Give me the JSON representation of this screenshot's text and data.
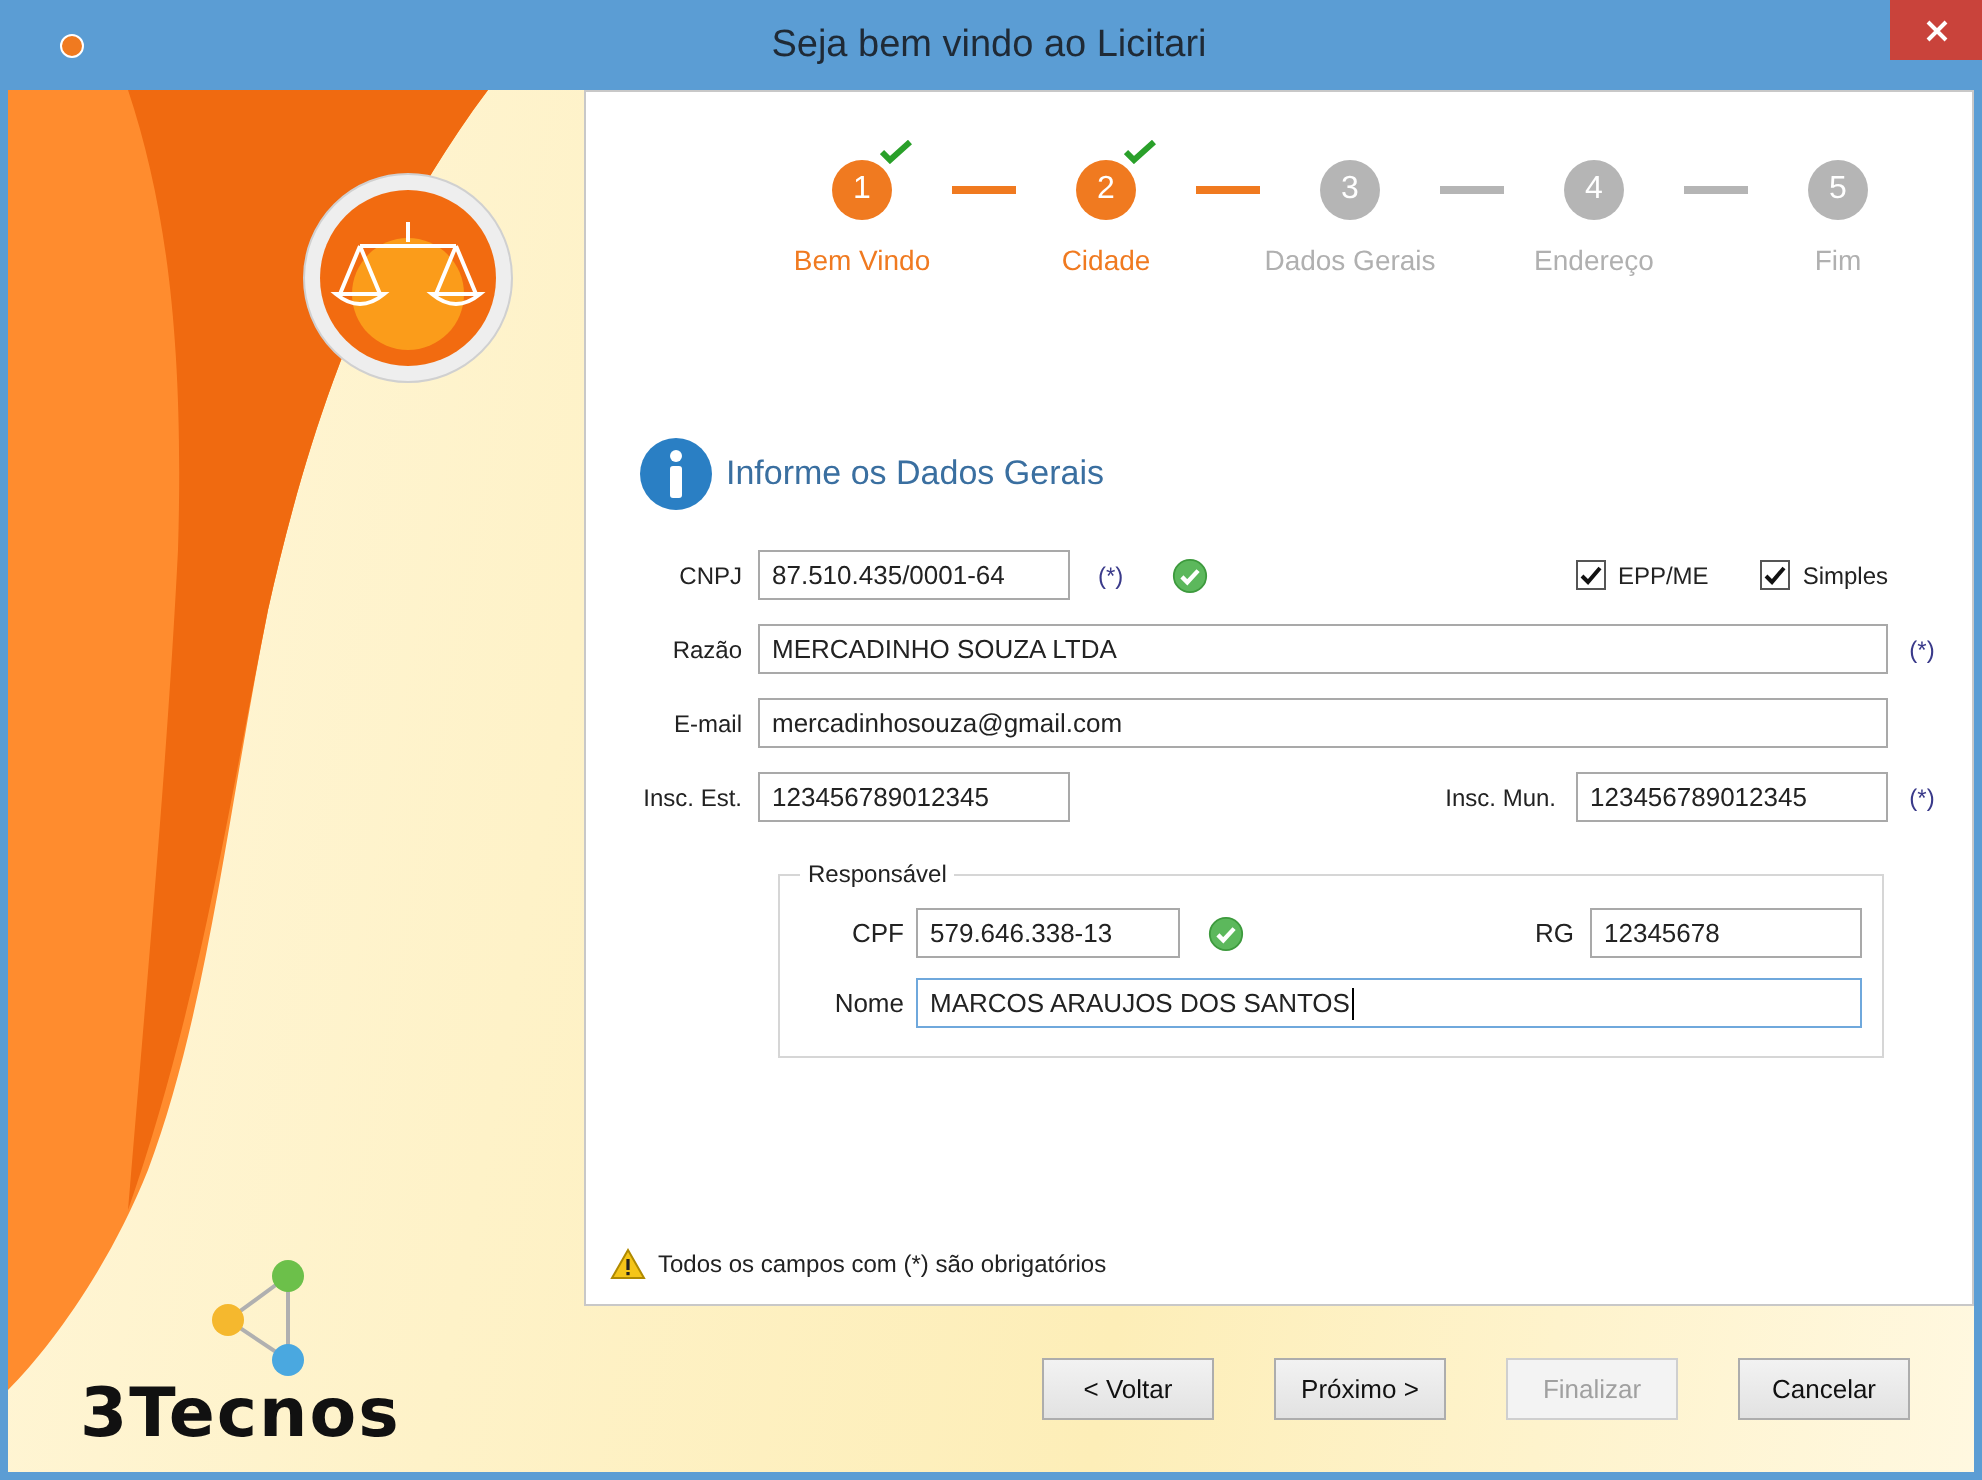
{
  "window": {
    "title": "Seja bem vindo ao Licitari"
  },
  "steps": [
    {
      "number": "1",
      "label": "Bem Vindo",
      "completed": true
    },
    {
      "number": "2",
      "label": "Cidade",
      "completed": true
    },
    {
      "number": "3",
      "label": "Dados Gerais",
      "completed": false
    },
    {
      "number": "4",
      "label": "Endereço",
      "completed": false
    },
    {
      "number": "5",
      "label": "Fim",
      "completed": false
    }
  ],
  "section_title": "Informe os Dados Gerais",
  "fields": {
    "cnpj": {
      "label": "CNPJ",
      "value": "87.510.435/0001-64",
      "required_mark": "(*)",
      "valid": true
    },
    "razao": {
      "label": "Razão",
      "value": "MERCADINHO SOUZA LTDA",
      "required_mark": "(*)"
    },
    "email": {
      "label": "E-mail",
      "value": "mercadinhosouza@gmail.com"
    },
    "insc_est": {
      "label": "Insc. Est.",
      "value": "123456789012345"
    },
    "insc_mun": {
      "label": "Insc. Mun.",
      "value": "123456789012345",
      "required_mark": "(*)"
    }
  },
  "options": [
    {
      "label": "EPP/ME",
      "checked": true
    },
    {
      "label": "Simples",
      "checked": true
    }
  ],
  "responsavel": {
    "legend": "Responsável",
    "cpf": {
      "label": "CPF",
      "value": "579.646.338-13",
      "valid": true
    },
    "rg": {
      "label": "RG",
      "value": "12345678"
    },
    "nome": {
      "label": "Nome",
      "value": "MARCOS ARAUJOS DOS SANTOS",
      "focused": true
    }
  },
  "footnote": "Todos os campos com (*) são obrigatórios",
  "buttons": [
    {
      "label": "< Voltar",
      "disabled": false
    },
    {
      "label": "Próximo >",
      "disabled": false
    },
    {
      "label": "Finalizar",
      "disabled": true
    },
    {
      "label": "Cancelar",
      "disabled": false
    }
  ],
  "logo": {
    "text": "3Tecnos"
  }
}
